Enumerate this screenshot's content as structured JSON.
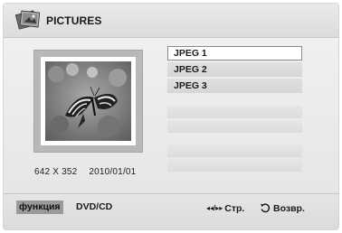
{
  "header": {
    "title": "PICTURES",
    "icon": "pictures-stack-icon"
  },
  "preview": {
    "image": "butterfly-photo",
    "resolution": "642 X 352",
    "date": "2010/01/01"
  },
  "file_list": {
    "items": [
      {
        "label": "JPEG 1",
        "selected": true
      },
      {
        "label": "JPEG 2",
        "selected": false
      },
      {
        "label": "JPEG 3",
        "selected": false
      }
    ],
    "empty_slots": 4
  },
  "footer": {
    "function_label": "функция",
    "source_label": "DVD/CD",
    "page_arrows": "◂◂/▸▸",
    "page_label": "Стр.",
    "return_icon": "return-arrow-icon",
    "return_label": "Возвр."
  },
  "colors": {
    "background": "#e8e8e8",
    "selection_border": "#8a8a8a",
    "function_highlight": "#9a9a9a"
  }
}
